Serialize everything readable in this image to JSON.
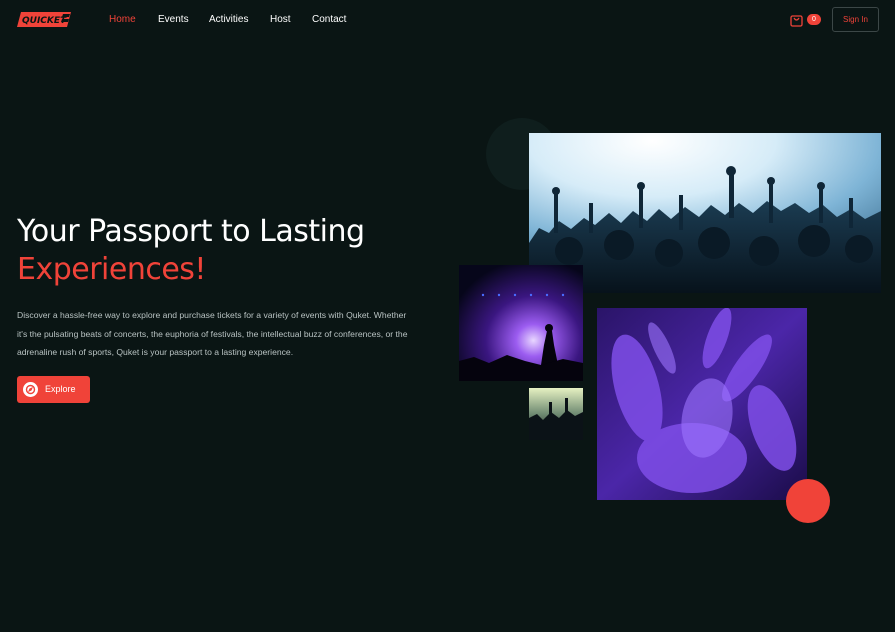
{
  "nav": {
    "logo_text": "QUICKET",
    "links": [
      {
        "label": "Home",
        "active": true
      },
      {
        "label": "Events",
        "active": false
      },
      {
        "label": "Activities",
        "active": false
      },
      {
        "label": "Host",
        "active": false
      },
      {
        "label": "Contact",
        "active": false
      }
    ],
    "cart_icon": "shopping-bag-icon",
    "cart_count": "0",
    "signin_label": "Sign In"
  },
  "hero": {
    "title_line1": "Your Passport to Lasting",
    "title_line2": "Experiences!",
    "description": "Discover a hassle-free way to explore and purchase tickets for a variety of events with Quket. Whether it's the pulsating beats of concerts, the euphoria of festivals, the intellectual buzz of conferences, or the adrenaline rush of sports, Quket is your passport to a lasting experience.",
    "explore_label": "Explore",
    "explore_icon": "compass-icon"
  },
  "colors": {
    "background": "#0a1514",
    "accent": "#f04339",
    "text": "#ffffff",
    "muted": "#b9c3c3"
  }
}
